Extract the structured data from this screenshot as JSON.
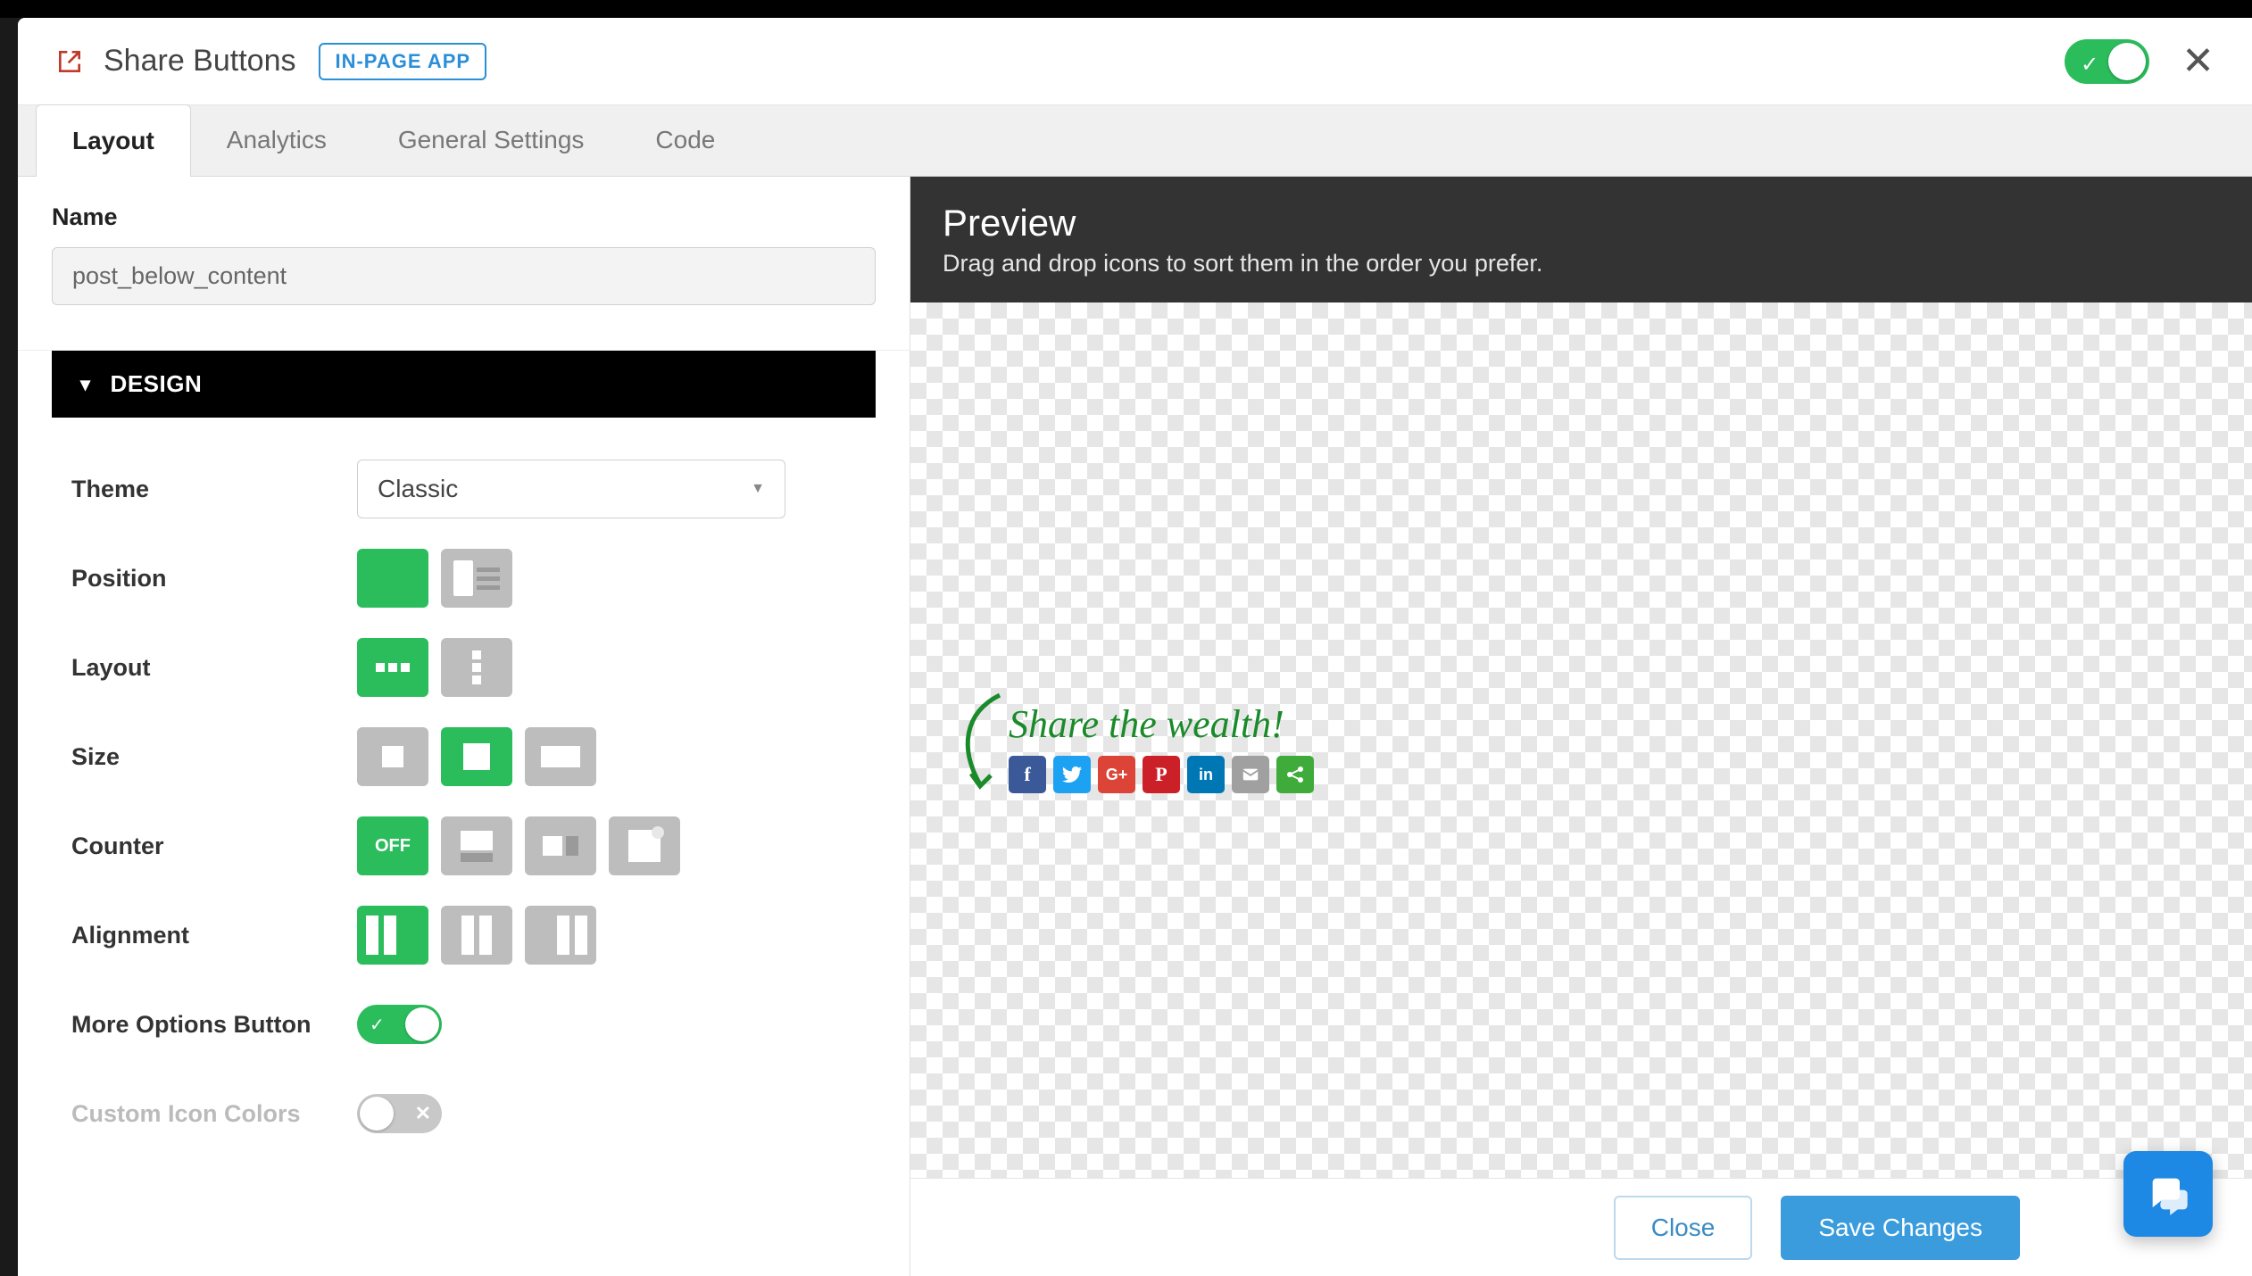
{
  "header": {
    "title": "Share Buttons",
    "badge": "IN-PAGE APP",
    "enabled": true
  },
  "tabs": [
    {
      "label": "Layout",
      "active": true
    },
    {
      "label": "Analytics",
      "active": false
    },
    {
      "label": "General Settings",
      "active": false
    },
    {
      "label": "Code",
      "active": false
    }
  ],
  "form": {
    "name_label": "Name",
    "name_value": "post_below_content"
  },
  "sections": {
    "design": {
      "title": "DESIGN",
      "rows": {
        "theme": {
          "label": "Theme",
          "value": "Classic"
        },
        "position": {
          "label": "Position",
          "selected": 0
        },
        "layout": {
          "label": "Layout",
          "selected": 0
        },
        "size": {
          "label": "Size",
          "selected": 1
        },
        "counter": {
          "label": "Counter",
          "off_label": "OFF",
          "selected": 0
        },
        "alignment": {
          "label": "Alignment",
          "selected": 0
        },
        "moreoptions": {
          "label": "More Options Button",
          "value": true
        },
        "customcolors": {
          "label": "Custom Icon Colors",
          "value": false
        }
      }
    }
  },
  "preview": {
    "title": "Preview",
    "subtitle": "Drag and drop icons to sort them in the order you prefer.",
    "share_text": "Share the wealth!",
    "icons": [
      {
        "name": "facebook",
        "glyph": "f",
        "cls": "fb"
      },
      {
        "name": "twitter",
        "glyph": "",
        "cls": "tw"
      },
      {
        "name": "googleplus",
        "glyph": "G+",
        "cls": "gp"
      },
      {
        "name": "pinterest",
        "glyph": "P",
        "cls": "pn"
      },
      {
        "name": "linkedin",
        "glyph": "in",
        "cls": "li"
      },
      {
        "name": "email",
        "glyph": "",
        "cls": "em"
      },
      {
        "name": "more",
        "glyph": "",
        "cls": "more"
      }
    ]
  },
  "footer": {
    "close": "Close",
    "save": "Save Changes"
  },
  "colors": {
    "accent": "#2bbd5c",
    "primary": "#3a9cdc"
  }
}
